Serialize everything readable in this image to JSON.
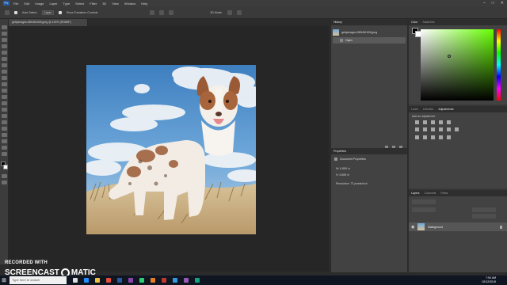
{
  "app": {
    "logo": "Ps"
  },
  "menubar": {
    "items": [
      "File",
      "Edit",
      "Image",
      "Layer",
      "Type",
      "Select",
      "Filter",
      "3D",
      "View",
      "Window",
      "Help"
    ]
  },
  "options": {
    "auto_select": "Auto-Select:",
    "layer": "Layer",
    "show_transform": "Show Transform Controls",
    "mode_3d": "3D Mode:"
  },
  "document": {
    "tab": "gettyimages-589461526.jpeg @ 100% (RGB/8*)"
  },
  "panels": {
    "history": {
      "tab": "History",
      "snapshot": "gettyimages-589461526.jpeg",
      "state": "Open"
    },
    "properties": {
      "tab": "Properties",
      "type": "Document Properties",
      "w": "W: 6.889 in",
      "h": "H: 6.889 in",
      "resolution": "Resolution: 72 pixels/inch"
    },
    "color": {
      "tabs": [
        "Color",
        "Swatches"
      ]
    },
    "adjustments": {
      "tabs": [
        "Learn",
        "Libraries",
        "Adjustments"
      ],
      "add": "Add an adjustment"
    },
    "layers": {
      "tabs": [
        "Layers",
        "Channels",
        "Paths"
      ],
      "layer_name": "Background"
    }
  },
  "watermark": {
    "line1": "RECORDED WITH",
    "word1": "SCREENCAST",
    "word2": "MATIC"
  },
  "taskbar": {
    "search_placeholder": "Type here to search",
    "time": "7:54 AM",
    "date": "02/12/2019"
  },
  "colors": {
    "accent": "#2a5b9e",
    "ui_dark": "#262626",
    "panel": "#383838"
  }
}
